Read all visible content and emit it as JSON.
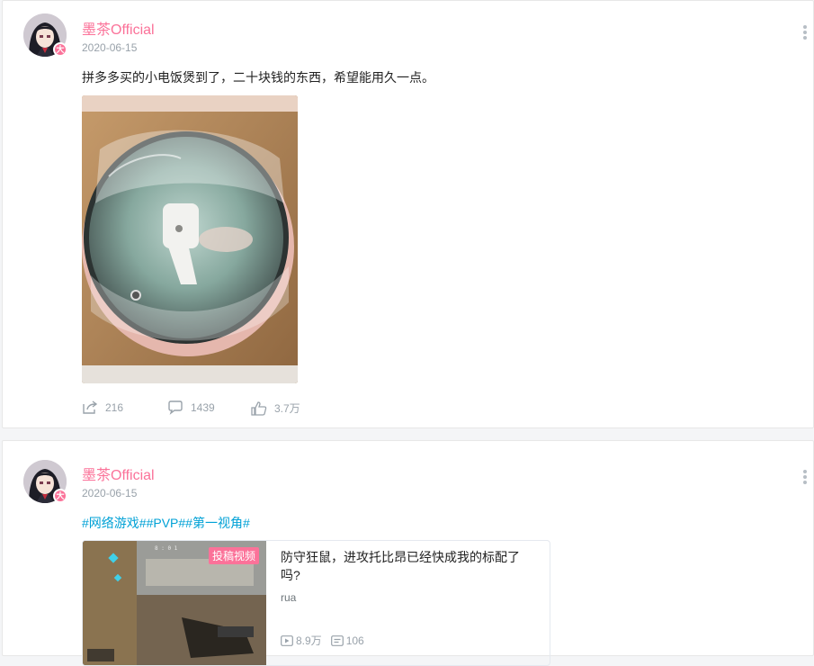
{
  "posts": [
    {
      "username": "墨茶Official",
      "date": "2020-06-15",
      "vip_badge": "大",
      "text": "拼多多买的小电饭煲到了，二十块钱的东西，希望能用久一点。",
      "actions": {
        "share_count": "216",
        "comment_count": "1439",
        "like_count": "3.7万"
      }
    },
    {
      "username": "墨茶Official",
      "date": "2020-06-15",
      "vip_badge": "大",
      "hashtags": [
        "#网络游戏#",
        "#PVP#",
        "#第一视角#"
      ],
      "video": {
        "tag": "投稿视频",
        "title": "防守狂鼠，进攻托比昂已经快成我的标配了吗?",
        "author": "rua",
        "views": "8.9万",
        "danmaku": "106"
      }
    }
  ],
  "icons": {
    "share": "share-icon",
    "comment": "comment-icon",
    "like": "like-icon",
    "more": "more-vertical-icon",
    "play": "play-icon",
    "danmaku": "danmaku-icon"
  },
  "colors": {
    "username": "#fb7299",
    "hashtag": "#00a1d6",
    "meta": "#99a2aa",
    "accent": "#00a1d6"
  }
}
